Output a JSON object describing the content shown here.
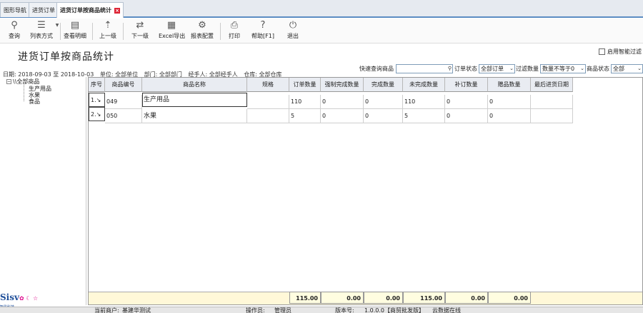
{
  "tabs": [
    {
      "label": "图形导航"
    },
    {
      "label": "进货订单"
    },
    {
      "label": "进货订单按商品统计",
      "close": "×"
    }
  ],
  "toolbar": {
    "query": "查询",
    "list_mode": "列表方式",
    "detail": "查看明细",
    "prev": "上一级",
    "next": "下一级",
    "excel": "Excel导出",
    "report_config": "报表配置",
    "print": "打印",
    "help": "帮助[F1]",
    "exit": "退出"
  },
  "page_title": "进货订单按商品统计",
  "smart_filter": "启用智能过滤",
  "filters": {
    "date_range": "日期: 2018-09-03  至 2018-10-03",
    "unit": "单位: 全部单位",
    "dept": "部门: 全部部门",
    "handler": "经手人: 全部经手人",
    "warehouse": "仓库: 全部仓库"
  },
  "quick": {
    "search_label": "快速查询商品",
    "search_value": "",
    "order_status_label": "订单状态",
    "order_status_value": "全部订单",
    "filter_qty_label": "过滤数量",
    "filter_qty_value": "数量不等于0",
    "product_status_label": "商品状态",
    "product_status_value": "全部"
  },
  "tree": {
    "root": "\\\\全部商品",
    "children": [
      "生产用品",
      "水果",
      "食品"
    ]
  },
  "grid": {
    "columns": [
      "序号",
      "商品编号",
      "商品名称",
      "规格",
      "订单数量",
      "强制完成数量",
      "完成数量",
      "未完成数量",
      "补订数量",
      "赠品数量",
      "最后进货日期"
    ],
    "rows": [
      {
        "seq": "1.↘",
        "code": "049",
        "name": "生产用品",
        "spec": "",
        "order_qty": "110",
        "forced": "0",
        "done": "0",
        "undone": "110",
        "reorder": "0",
        "gift": "0",
        "last_date": ""
      },
      {
        "seq": "2.↘",
        "code": "050",
        "name": "水果",
        "spec": "",
        "order_qty": "5",
        "forced": "0",
        "done": "0",
        "undone": "5",
        "reorder": "0",
        "gift": "0",
        "last_date": ""
      }
    ],
    "totals": {
      "order_qty": "115.00",
      "forced": "0.00",
      "done": "0.00",
      "undone": "115.00",
      "reorder": "0.00",
      "gift": "0.00"
    }
  },
  "status": {
    "current_account": "当前商户:",
    "account_value": "基建华测试",
    "operator": "操作员:",
    "operator_value": "管理员",
    "version": "版本号:",
    "version_value": "1.0.0.0【商贸批发版】",
    "cloud": "云数据在线"
  },
  "logo_text": "Sisv",
  "logo_sub": "智盈科技"
}
